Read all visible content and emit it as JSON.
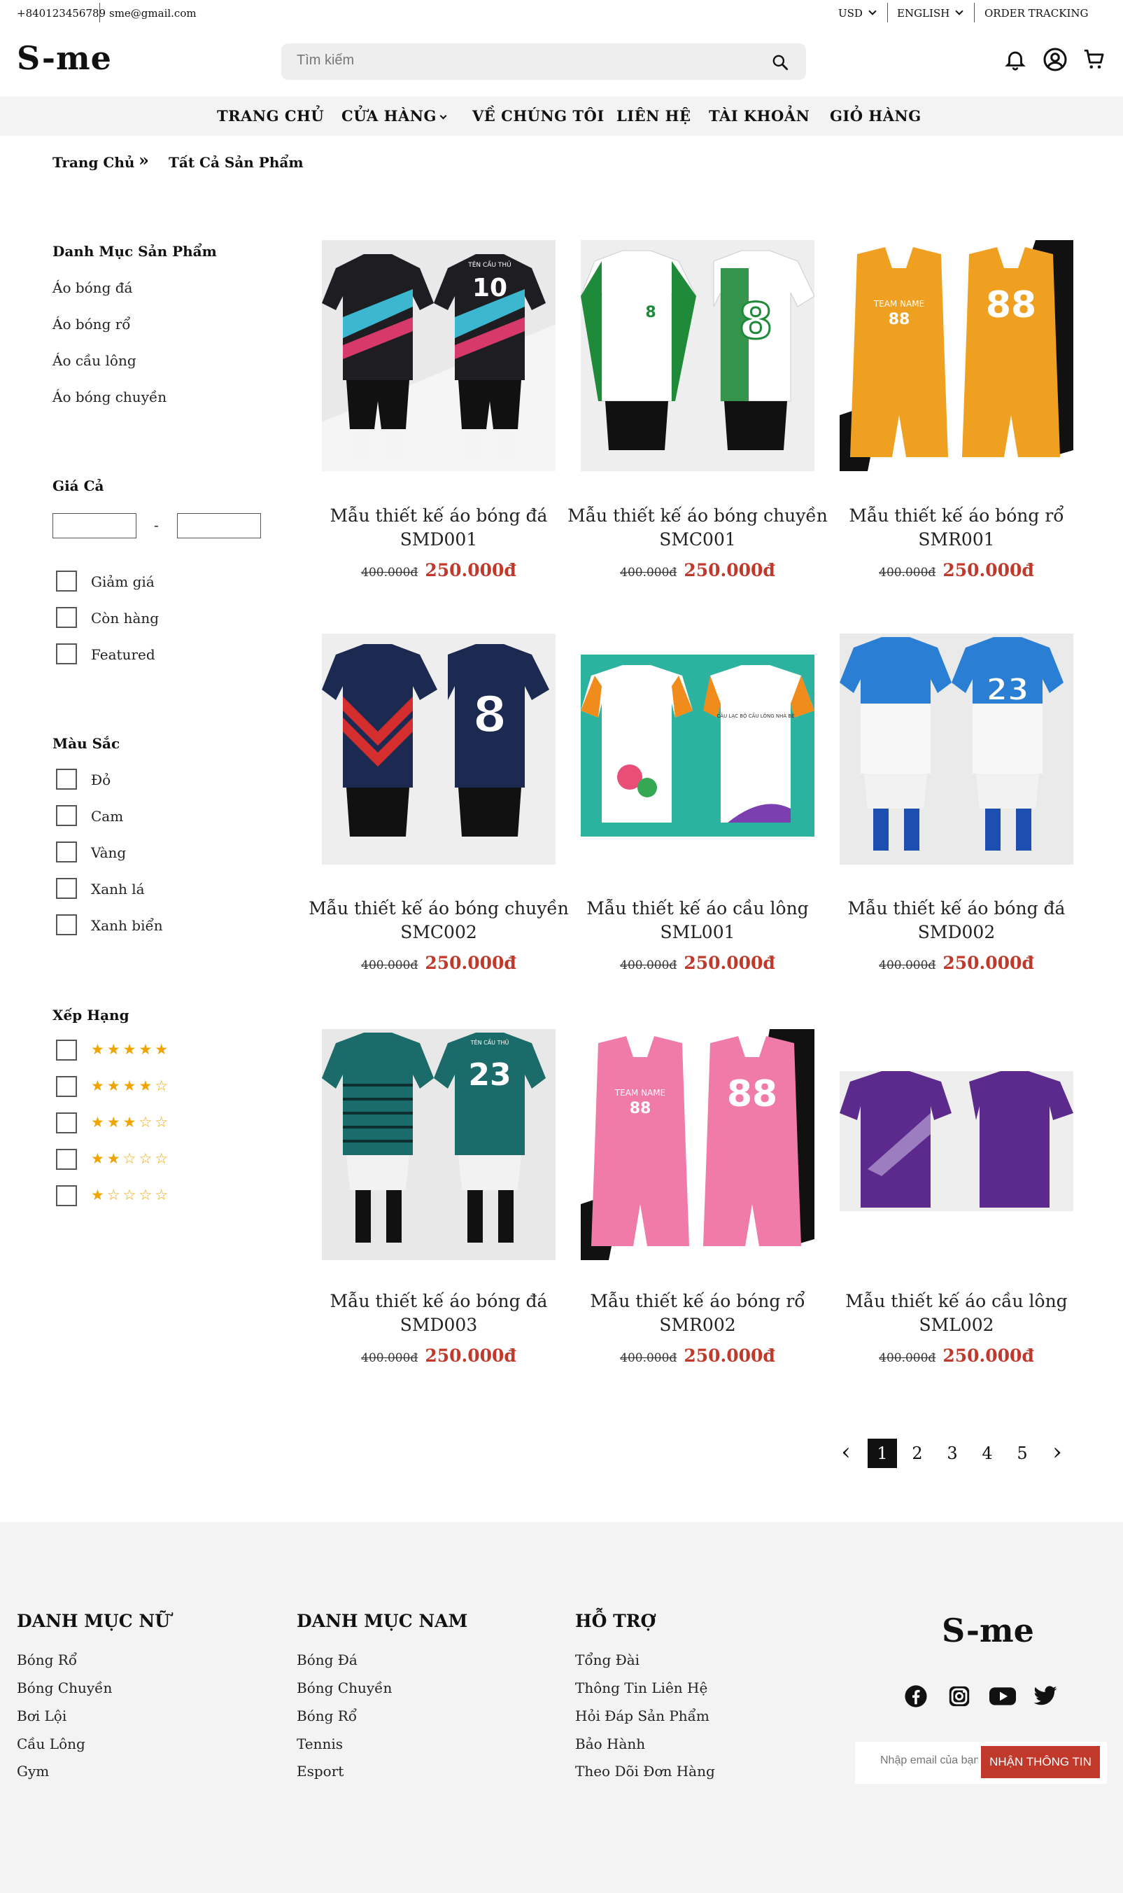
{
  "topbar": {
    "phone": "+840123456789",
    "email": "sme@gmail.com",
    "currency": "USD",
    "language": "ENGLISH",
    "order_tracking": "ORDER TRACKING"
  },
  "header": {
    "logo": "S-me",
    "search_placeholder": "Tìm kiếm",
    "icons": [
      "bell-icon",
      "user-icon",
      "cart-icon"
    ]
  },
  "nav": {
    "items": [
      "TRANG CHỦ",
      "CỬA HÀNG",
      "VỀ CHÚNG TÔI",
      "LIÊN HỆ",
      "TÀI KHOẢN",
      "GIỎ HÀNG"
    ]
  },
  "breadcrumb": {
    "home": "Trang Chủ",
    "separator": "»",
    "current": "Tất Cả Sản Phẩm"
  },
  "sidebar": {
    "category_title": "Danh Mục Sản Phẩm",
    "categories": [
      "Áo bóng đá",
      "Áo bóng rổ",
      "Áo cầu lông",
      "Áo bóng chuyền"
    ],
    "price_title": "Giá Cả",
    "price_separator": "-",
    "filters": [
      "Giảm giá",
      "Còn hàng",
      "Featured"
    ],
    "color_title": "Màu Sắc",
    "colors": [
      "Đỏ",
      "Cam",
      "Vàng",
      "Xanh lá",
      "Xanh biển"
    ],
    "rating_title": "Xếp Hạng",
    "ratings": [
      "★★★★★",
      "★★★★☆",
      "★★★☆☆",
      "★★☆☆☆",
      "★☆☆☆☆"
    ]
  },
  "products": [
    {
      "title": "Mẫu thiết kế áo bóng đá SMD001",
      "old_price": "400.000đ",
      "price": "250.000đ"
    },
    {
      "title": "Mẫu thiết kế áo bóng chuyền SMC001",
      "old_price": "400.000đ",
      "price": "250.000đ"
    },
    {
      "title": "Mẫu thiết kế áo bóng rổ SMR001",
      "old_price": "400.000đ",
      "price": "250.000đ"
    },
    {
      "title": "Mẫu thiết kế áo bóng chuyền SMC002",
      "old_price": "400.000đ",
      "price": "250.000đ"
    },
    {
      "title": "Mẫu thiết kế áo cầu lông SML001",
      "old_price": "400.000đ",
      "price": "250.000đ"
    },
    {
      "title": "Mẫu thiết kế áo bóng đá SMD002",
      "old_price": "400.000đ",
      "price": "250.000đ"
    },
    {
      "title": "Mẫu thiết kế áo bóng đá SMD003",
      "old_price": "400.000đ",
      "price": "250.000đ"
    },
    {
      "title": "Mẫu thiết kế áo bóng rổ SMR002",
      "old_price": "400.000đ",
      "price": "250.000đ"
    },
    {
      "title": "Mẫu thiết kế áo cầu lông SML002",
      "old_price": "400.000đ",
      "price": "250.000đ"
    }
  ],
  "product_images": {
    "jersey_numbers": [
      "10",
      "8",
      "88",
      "8",
      "23",
      "88"
    ],
    "jersey_name_texts": [
      "TÊN CẦU THỦ",
      "TEAM NAME",
      "CÂU LẠC BỘ CẦU LÔNG NHÀ BÈ",
      "TÊN CẦU THỦ"
    ]
  },
  "pagination": {
    "pages": [
      "1",
      "2",
      "3",
      "4",
      "5"
    ],
    "active": "1",
    "prev": "‹",
    "next": "›"
  },
  "footer": {
    "columns": [
      {
        "title": "DANH MỤC NỮ",
        "links": [
          "Bóng Rổ",
          "Bóng Chuyền",
          "Bơi Lội",
          "Cầu Lông",
          "Gym"
        ]
      },
      {
        "title": "DANH MỤC NAM",
        "links": [
          "Bóng Đá",
          "Bóng Chuyền",
          "Bóng Rổ",
          "Tennis",
          "Esport"
        ]
      },
      {
        "title": "HỖ TRỢ",
        "links": [
          "Tổng Đài",
          "Thông Tin Liên Hệ",
          "Hỏi Đáp Sản Phẩm",
          "Bảo Hành",
          "Theo Dõi Đơn Hàng"
        ]
      }
    ],
    "logo": "S-me",
    "social_icons": [
      "facebook-icon",
      "instagram-icon",
      "youtube-icon",
      "twitter-icon"
    ],
    "email_placeholder": "Nhập email của bạn",
    "subscribe_label": "NHẬN THÔNG TIN"
  },
  "colors": {
    "price_red": "#c0392b",
    "star_yellow": "#f2a300",
    "nav_bg": "#f3f3f3"
  }
}
